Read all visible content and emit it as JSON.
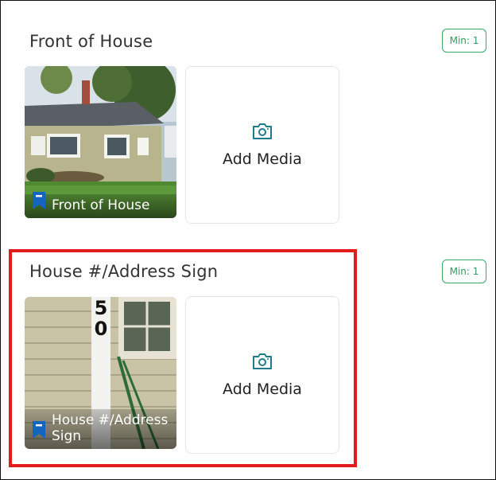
{
  "sections": [
    {
      "title": "Front of House",
      "min_label": "Min: 1",
      "photo_caption": "Front of House",
      "add_media_label": "Add Media"
    },
    {
      "title": "House #/Address Sign",
      "min_label": "Min: 1",
      "photo_caption": "House #/Address Sign",
      "photo_house_number": "50",
      "add_media_label": "Add Media"
    }
  ],
  "colors": {
    "accent_green": "#2f9c5e",
    "bookmark_blue": "#1565c0",
    "highlight_red": "#e31b1b"
  },
  "icons": [
    "camera-icon",
    "bookmark-icon"
  ]
}
